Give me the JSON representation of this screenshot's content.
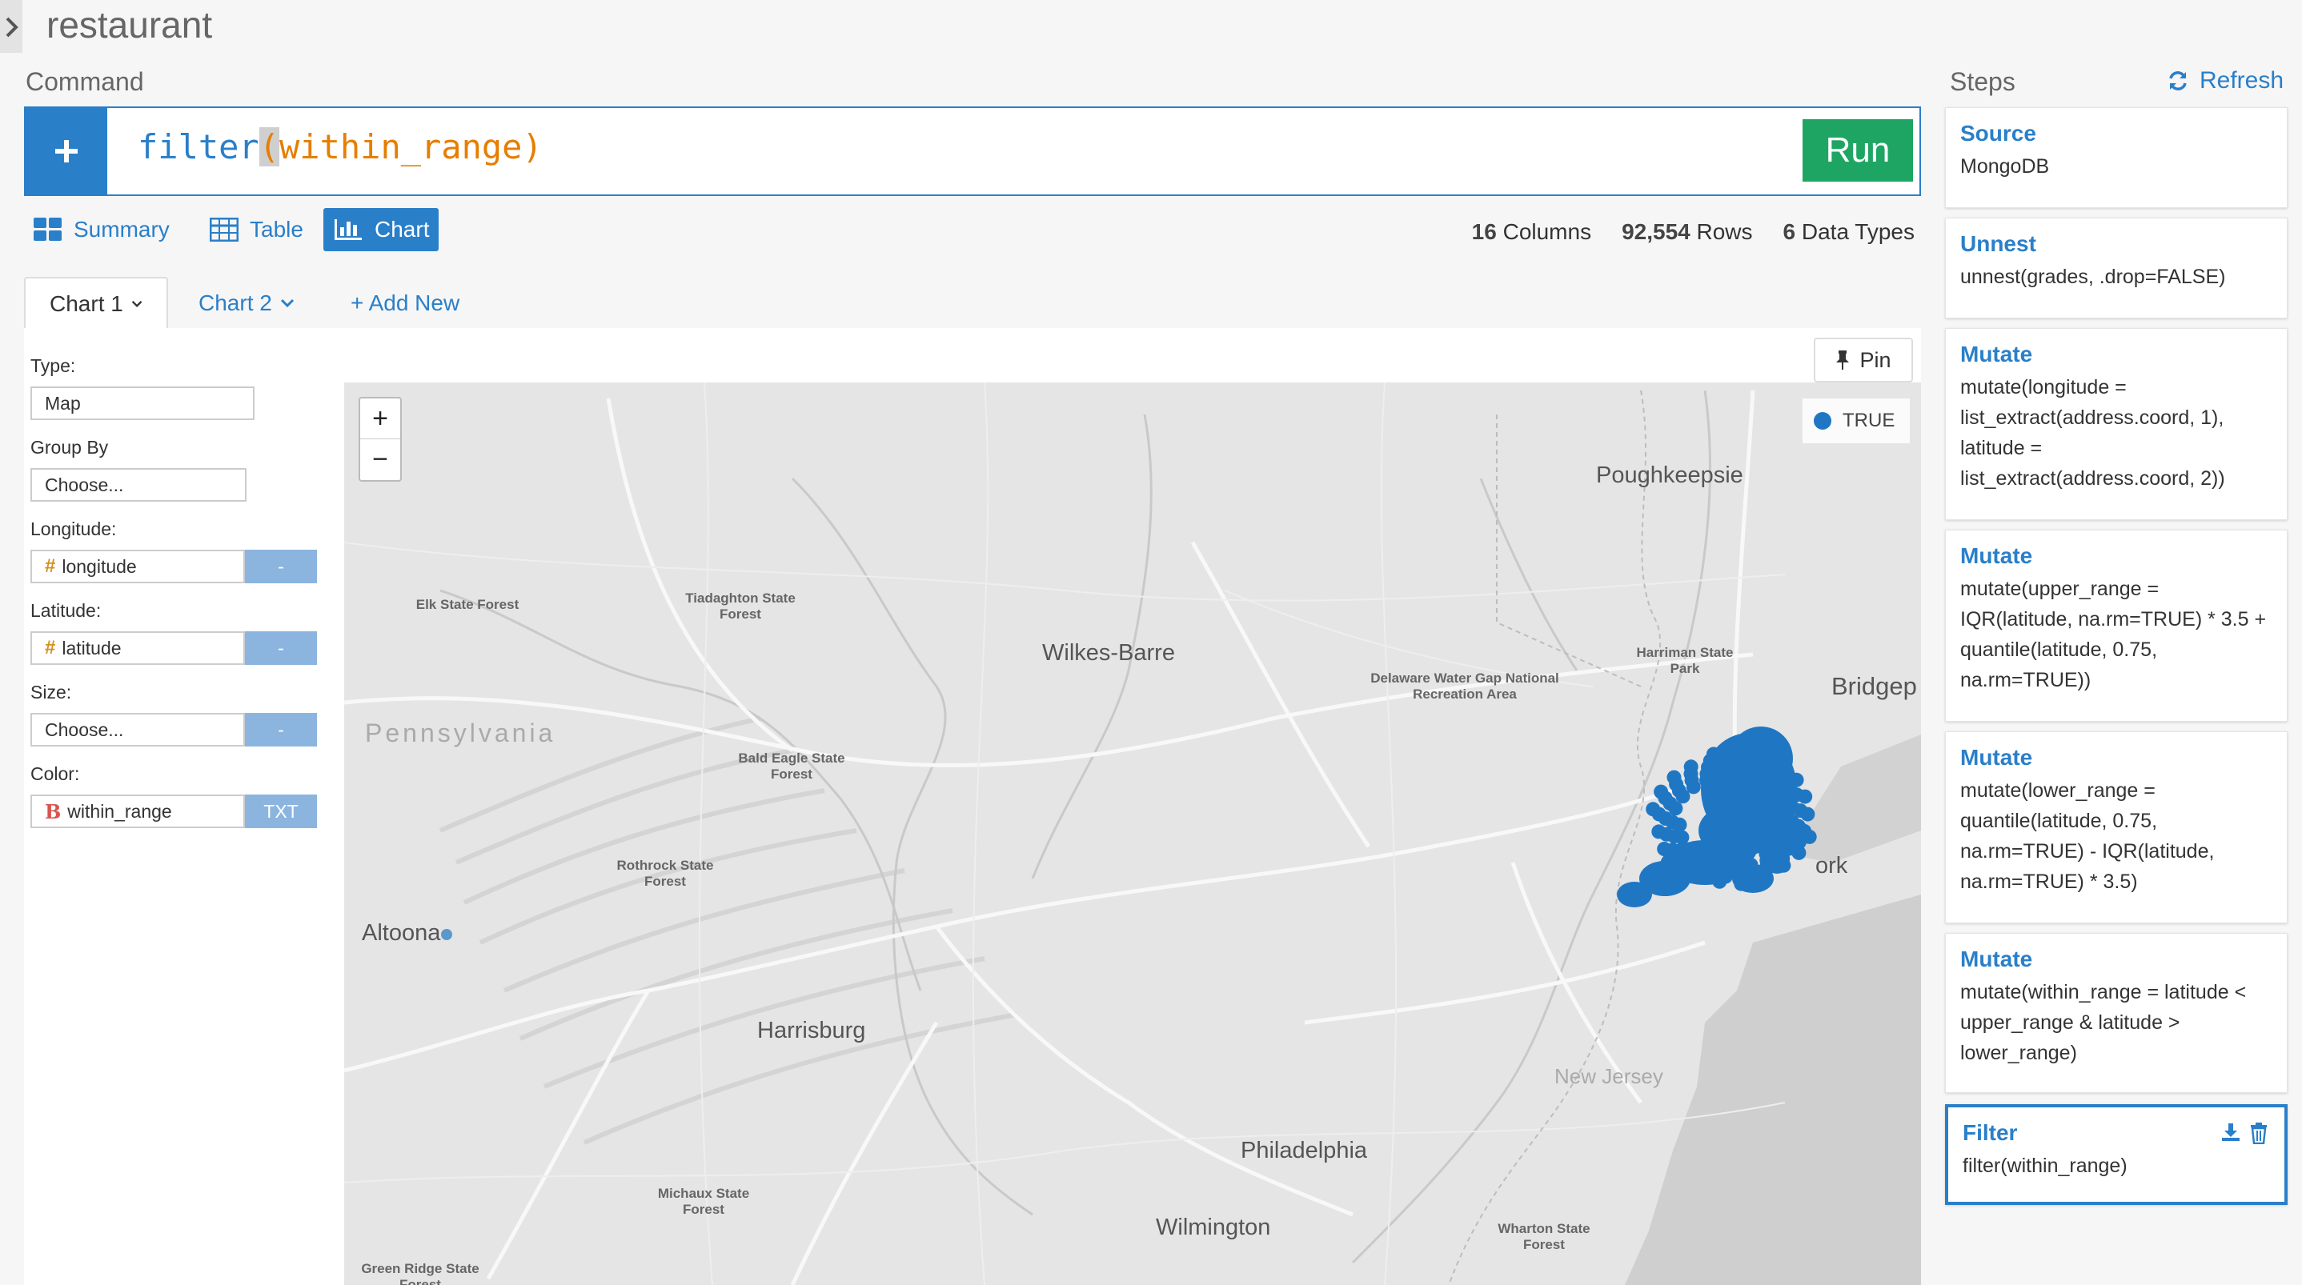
{
  "app": {
    "project_title": "restaurant"
  },
  "command": {
    "label": "Command",
    "code_fn": "filter",
    "code_open": "(",
    "code_arg": "within_range",
    "code_close": ")",
    "run_label": "Run"
  },
  "views": {
    "summary": "Summary",
    "table": "Table",
    "chart": "Chart",
    "active": "chart"
  },
  "stats": {
    "columns_value": "16",
    "columns_label": "Columns",
    "rows_value": "92,554",
    "rows_label": "Rows",
    "types_value": "6",
    "types_label": "Data Types"
  },
  "chart_tabs": {
    "tab1": "Chart 1",
    "tab2": "Chart 2",
    "add_new": "+ Add New"
  },
  "config": {
    "type_label": "Type:",
    "type_value": "Map",
    "group_label": "Group By",
    "group_value": "Choose...",
    "lon_label": "Longitude:",
    "lon_value": "longitude",
    "lon_btn": "-",
    "lat_label": "Latitude:",
    "lat_value": "latitude",
    "lat_btn": "-",
    "size_label": "Size:",
    "size_value": "Choose...",
    "size_btn": "-",
    "color_label": "Color:",
    "color_value": "within_range",
    "color_btn": "TXT",
    "num_type_glyph": "#",
    "bool_type_glyph": "B"
  },
  "map": {
    "pin_label": "Pin",
    "zoom_in": "+",
    "zoom_out": "−",
    "legend_label": "TRUE",
    "point_color": "#1f77c4",
    "cities": {
      "poughkeepsie": "Poughkeepsie",
      "wilkes_barre": "Wilkes-Barre",
      "bridgeport": "Bridgep",
      "altoona": "Altoona",
      "harrisburg": "Harrisburg",
      "philadelphia": "Philadelphia",
      "wilmington": "Wilmington",
      "york": "ork",
      "new_jersey": "New Jersey",
      "pennsylvania": "Pennsylvania"
    },
    "parks": {
      "elk": "Elk State Forest",
      "tiadaghton": "Tiadaghton State Forest",
      "harriman": "Harriman State Park",
      "delaware": "Delaware Water Gap National Recreation Area",
      "bald_eagle": "Bald Eagle State Forest",
      "rothrock": "Rothrock State Forest",
      "michaux": "Michaux State Forest",
      "wharton": "Wharton State Forest",
      "green_ridge": "Green Ridge State Forest"
    }
  },
  "steps": {
    "label": "Steps",
    "refresh_label": "Refresh",
    "items": [
      {
        "title": "Source",
        "body": "MongoDB"
      },
      {
        "title": "Unnest",
        "body": "unnest(grades, .drop=FALSE)"
      },
      {
        "title": "Mutate",
        "body": "mutate(longitude = list_extract(address.coord, 1), latitude = list_extract(address.coord, 2))"
      },
      {
        "title": "Mutate",
        "body": "mutate(upper_range = IQR(latitude, na.rm=TRUE) * 3.5 + quantile(latitude, 0.75, na.rm=TRUE))"
      },
      {
        "title": "Mutate",
        "body": "mutate(lower_range = quantile(latitude, 0.75, na.rm=TRUE) - IQR(latitude, na.rm=TRUE) * 3.5)"
      },
      {
        "title": "Mutate",
        "body": "mutate(within_range = latitude < upper_range & latitude > lower_range)"
      },
      {
        "title": "Filter",
        "body": "filter(within_range)"
      }
    ]
  }
}
